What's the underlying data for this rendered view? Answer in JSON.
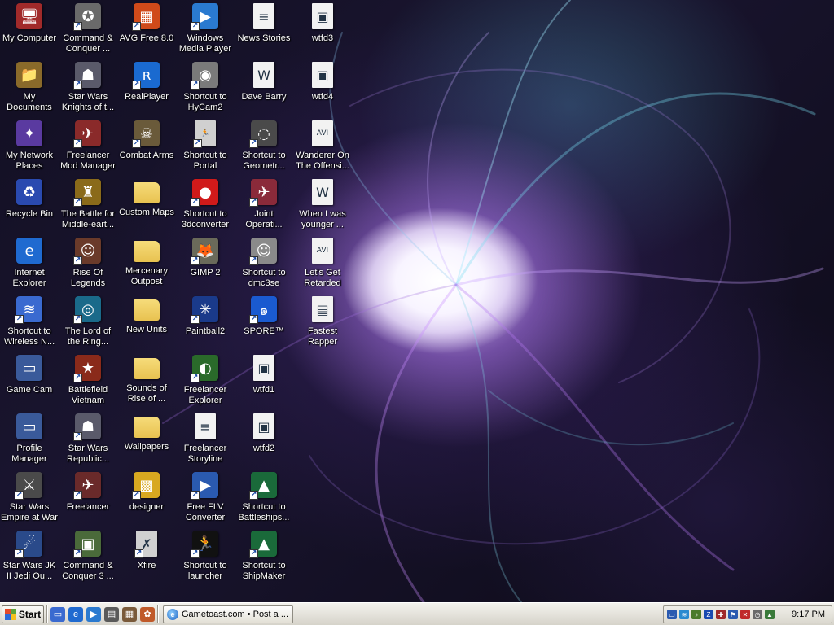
{
  "desktop": {
    "icons": [
      {
        "label": "My Computer",
        "icon": "computer-icon",
        "color": "#a12a2a",
        "glyph": "🖥",
        "shortcut": false
      },
      {
        "label": "My\nDocuments",
        "icon": "documents-folder-icon",
        "color": "#8a6a2a",
        "glyph": "📁",
        "shortcut": false
      },
      {
        "label": "My Network\nPlaces",
        "icon": "network-icon",
        "color": "#5a3aa0",
        "glyph": "✦",
        "shortcut": false
      },
      {
        "label": "Recycle Bin",
        "icon": "recycle-bin-icon",
        "color": "#2a4ab0",
        "glyph": "♻",
        "shortcut": false
      },
      {
        "label": "Internet\nExplorer",
        "icon": "internet-explorer-icon",
        "color": "#1f6ad0",
        "glyph": "e",
        "shortcut": false
      },
      {
        "label": "Shortcut to\nWireless N...",
        "icon": "wireless-icon",
        "color": "#3a6ad0",
        "glyph": "≋",
        "shortcut": true
      },
      {
        "label": "Game Cam",
        "icon": "app-window-icon",
        "color": "#3a5a9a",
        "glyph": "▭",
        "shortcut": false
      },
      {
        "label": "Profile\nManager",
        "icon": "app-window-icon",
        "color": "#3a5a9a",
        "glyph": "▭",
        "shortcut": false
      },
      {
        "label": "Star Wars\nEmpire at War",
        "icon": "star-wars-empire-icon",
        "color": "#4a4a4a",
        "glyph": "⚔",
        "shortcut": true
      },
      {
        "label": "Star Wars JK\nII Jedi Ou...",
        "icon": "star-wars-jk-icon",
        "color": "#2a4a8a",
        "glyph": "☄",
        "shortcut": true
      },
      {
        "label": "Command &\nConquer ...",
        "icon": "command-conquer-icon",
        "color": "#6a6a6a",
        "glyph": "✪",
        "shortcut": true
      },
      {
        "label": "Star Wars\nKnights of t...",
        "icon": "kotor-icon",
        "color": "#5a5a6a",
        "glyph": "☗",
        "shortcut": true
      },
      {
        "label": "Freelancer\nMod Manager",
        "icon": "freelancer-mod-icon",
        "color": "#8a2a2a",
        "glyph": "✈",
        "shortcut": true
      },
      {
        "label": "The Battle for\nMiddle-eart...",
        "icon": "battle-middle-earth-icon",
        "color": "#8a6a1a",
        "glyph": "♜",
        "shortcut": true
      },
      {
        "label": "Rise Of\nLegends",
        "icon": "rise-of-legends-icon",
        "color": "#6a3a2a",
        "glyph": "☺",
        "shortcut": true
      },
      {
        "label": "The Lord of\nthe Ring...",
        "icon": "lotr-icon",
        "color": "#1a6a8a",
        "glyph": "◎",
        "shortcut": true
      },
      {
        "label": "Battlefield\nVietnam",
        "icon": "battlefield-icon",
        "color": "#8a2a1a",
        "glyph": "★",
        "shortcut": true
      },
      {
        "label": "Star Wars\nRepublic...",
        "icon": "republic-commando-icon",
        "color": "#5a5a6a",
        "glyph": "☗",
        "shortcut": true
      },
      {
        "label": "Freelancer",
        "icon": "freelancer-icon",
        "color": "#6a2a2a",
        "glyph": "✈",
        "shortcut": true
      },
      {
        "label": "Command &\nConquer 3 ...",
        "icon": "command-conquer-3-icon",
        "color": "#4a6a3a",
        "glyph": "▣",
        "shortcut": true
      },
      {
        "label": "AVG Free 8.0",
        "icon": "avg-antivirus-icon",
        "color": "#d04a1a",
        "glyph": "▦",
        "shortcut": true
      },
      {
        "label": "RealPlayer",
        "icon": "realplayer-icon",
        "color": "#1a6ad0",
        "glyph": "ʀ",
        "shortcut": true
      },
      {
        "label": "Combat Arms",
        "icon": "combat-arms-icon",
        "color": "#6a5a3a",
        "glyph": "☠",
        "shortcut": true
      },
      {
        "label": "Custom Maps",
        "icon": "folder-icon",
        "color": "#e8c250",
        "glyph": "",
        "shortcut": false
      },
      {
        "label": "Mercenary\nOutpost",
        "icon": "folder-icon",
        "color": "#e8c250",
        "glyph": "",
        "shortcut": false
      },
      {
        "label": "New Units",
        "icon": "folder-icon",
        "color": "#e8c250",
        "glyph": "",
        "shortcut": false
      },
      {
        "label": "Sounds of\nRise of ...",
        "icon": "folder-icon",
        "color": "#e8c250",
        "glyph": "",
        "shortcut": false
      },
      {
        "label": "Wallpapers",
        "icon": "folder-icon",
        "color": "#e8c250",
        "glyph": "",
        "shortcut": false
      },
      {
        "label": "designer",
        "icon": "designer-brick-icon",
        "color": "#d8a820",
        "glyph": "▩",
        "shortcut": true
      },
      {
        "label": "Xfire",
        "icon": "xfire-icon",
        "color": "#d0d0d0",
        "glyph": "✗",
        "shortcut": true
      },
      {
        "label": "Windows\nMedia Player",
        "icon": "media-player-icon",
        "color": "#2a7ad0",
        "glyph": "▶",
        "shortcut": true
      },
      {
        "label": "Shortcut to\nHyCam2",
        "icon": "hycam-icon",
        "color": "#7a7a7a",
        "glyph": "◉",
        "shortcut": true
      },
      {
        "label": "Shortcut to\nPortal",
        "icon": "portal-icon",
        "color": "#d0d0d0",
        "glyph": "🏃",
        "shortcut": true
      },
      {
        "label": "Shortcut to\n3dconverter",
        "icon": "3dconverter-icon",
        "color": "#d01a1a",
        "glyph": "●",
        "shortcut": true
      },
      {
        "label": "GIMP 2",
        "icon": "gimp-icon",
        "color": "#6a6a5a",
        "glyph": "🦊",
        "shortcut": true
      },
      {
        "label": "Paintball2",
        "icon": "paintball-icon",
        "color": "#1a3a8a",
        "glyph": "✳",
        "shortcut": true
      },
      {
        "label": "Freelancer\nExplorer",
        "icon": "freelancer-explorer-icon",
        "color": "#2a6a2a",
        "glyph": "◐",
        "shortcut": true
      },
      {
        "label": "Freelancer\nStoryline",
        "icon": "text-document-icon",
        "color": "#f2f2f2",
        "glyph": "≡",
        "shortcut": false
      },
      {
        "label": "Free FLV\nConverter",
        "icon": "flv-converter-icon",
        "color": "#2a5ab0",
        "glyph": "▶",
        "shortcut": true
      },
      {
        "label": "Shortcut to\nlauncher",
        "icon": "launcher-icon",
        "color": "#111111",
        "glyph": "🏃",
        "shortcut": true
      },
      {
        "label": "News Stories",
        "icon": "text-document-icon",
        "color": "#f2f2f2",
        "glyph": "≡",
        "shortcut": false
      },
      {
        "label": "Dave Barry",
        "icon": "word-document-icon",
        "color": "#f2f2f2",
        "glyph": "W",
        "shortcut": false
      },
      {
        "label": "Shortcut to\nGeometr...",
        "icon": "geometry-wars-icon",
        "color": "#4a4a4a",
        "glyph": "◌",
        "shortcut": true
      },
      {
        "label": "Joint\nOperati...",
        "icon": "joint-ops-icon",
        "color": "#8a2a3a",
        "glyph": "✈",
        "shortcut": true
      },
      {
        "label": "Shortcut to\ndmc3se",
        "icon": "dmc3se-icon",
        "color": "#8a8a8a",
        "glyph": "☺",
        "shortcut": true
      },
      {
        "label": "SPORE™",
        "icon": "spore-icon",
        "color": "#1a5ad0",
        "glyph": "๑",
        "shortcut": true
      },
      {
        "label": "wtfd1",
        "icon": "image-file-icon",
        "color": "#f2f2f2",
        "glyph": "▣",
        "shortcut": false
      },
      {
        "label": "wtfd2",
        "icon": "image-file-icon",
        "color": "#f2f2f2",
        "glyph": "▣",
        "shortcut": false
      },
      {
        "label": "Shortcut to\nBattleships...",
        "icon": "battleships-icon",
        "color": "#1a6a3a",
        "glyph": "▲",
        "shortcut": true
      },
      {
        "label": "Shortcut to\nShipMaker",
        "icon": "shipmaker-icon",
        "color": "#1a6a3a",
        "glyph": "▲",
        "shortcut": true
      },
      {
        "label": "wtfd3",
        "icon": "image-file-icon",
        "color": "#f2f2f2",
        "glyph": "▣",
        "shortcut": false
      },
      {
        "label": "wtfd4",
        "icon": "image-file-icon",
        "color": "#f2f2f2",
        "glyph": "▣",
        "shortcut": false
      },
      {
        "label": "Wanderer On\nThe Offensi...",
        "icon": "avi-video-icon",
        "color": "#f2f2f2",
        "glyph": "AVI",
        "shortcut": false
      },
      {
        "label": "When I was\nyounger ...",
        "icon": "word-document-icon",
        "color": "#f2f2f2",
        "glyph": "W",
        "shortcut": false
      },
      {
        "label": "Let's Get\nRetarded",
        "icon": "avi-video-icon",
        "color": "#f2f2f2",
        "glyph": "AVI",
        "shortcut": false
      },
      {
        "label": "Fastest\nRapper",
        "icon": "video-file-icon",
        "color": "#f2f2f2",
        "glyph": "▤",
        "shortcut": false
      }
    ]
  },
  "taskbar": {
    "start_label": "Start",
    "quick_launch": [
      {
        "icon": "show-desktop-icon",
        "color": "#3a6ad0",
        "glyph": "▭"
      },
      {
        "icon": "internet-explorer-icon",
        "color": "#1f6ad0",
        "glyph": "e"
      },
      {
        "icon": "media-player-icon",
        "color": "#2a7ad0",
        "glyph": "▶"
      },
      {
        "icon": "app-icon",
        "color": "#5a5a5a",
        "glyph": "▤"
      },
      {
        "icon": "app-icon",
        "color": "#7a5a3a",
        "glyph": "▦"
      },
      {
        "icon": "app-icon",
        "color": "#c05a2a",
        "glyph": "✿"
      }
    ],
    "window_button_label": "Gametoast.com • Post a ...",
    "tray_icons": [
      {
        "icon": "network-tray-icon",
        "color": "#2a5ab0",
        "glyph": "▭"
      },
      {
        "icon": "wireless-tray-icon",
        "color": "#2a8ad0",
        "glyph": "≋"
      },
      {
        "icon": "volume-tray-icon",
        "color": "#4a7a2a",
        "glyph": "♪"
      },
      {
        "icon": "zd-tray-icon",
        "color": "#1a4ab0",
        "glyph": "Z"
      },
      {
        "icon": "shield-tray-icon",
        "color": "#a02a2a",
        "glyph": "✚"
      },
      {
        "icon": "flag-tray-icon",
        "color": "#2a5ab0",
        "glyph": "⚑"
      },
      {
        "icon": "avg-tray-icon",
        "color": "#c02a2a",
        "glyph": "✕"
      },
      {
        "icon": "clock-tray-icon",
        "color": "#6a6a6a",
        "glyph": "◷"
      },
      {
        "icon": "app-tray-icon",
        "color": "#3a7a3a",
        "glyph": "▲"
      }
    ],
    "clock": "9:17 PM"
  }
}
